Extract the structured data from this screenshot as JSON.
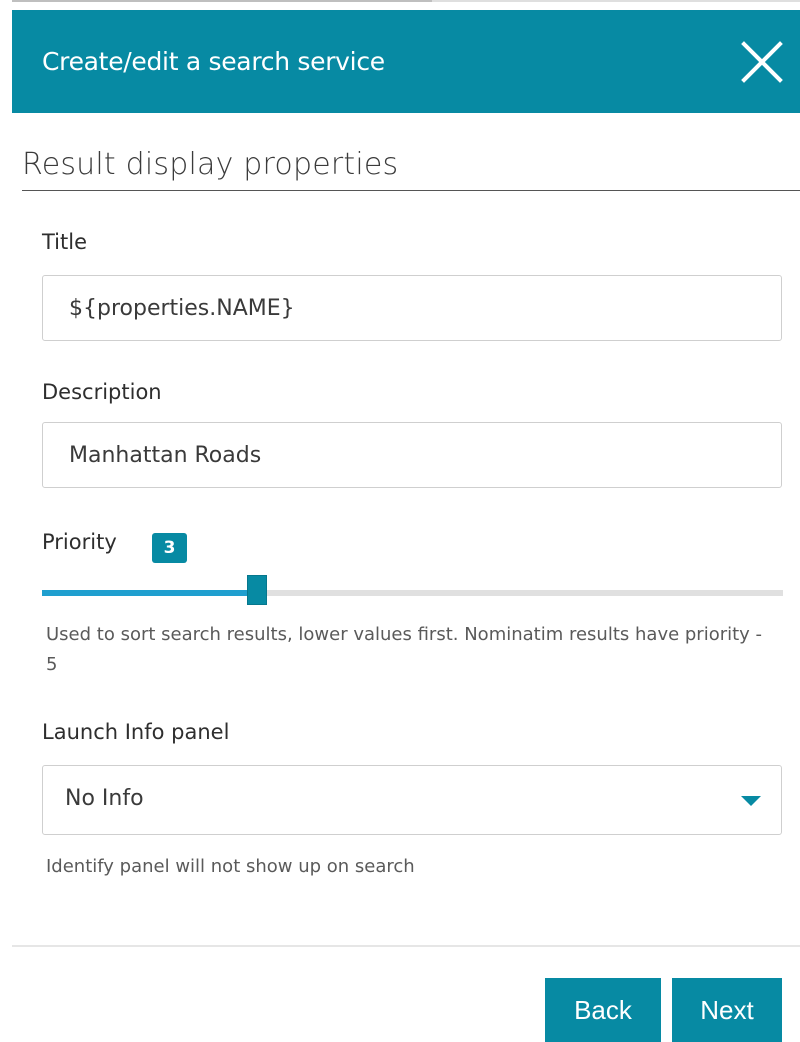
{
  "dialog": {
    "title": "Create/edit a search service",
    "close_icon": "close-icon"
  },
  "section": {
    "title": "Result display properties"
  },
  "fields": {
    "title": {
      "label": "Title",
      "value": "${properties.NAME}"
    },
    "description": {
      "label": "Description",
      "value": "Manhattan Roads"
    },
    "priority": {
      "label": "Priority",
      "value": "3",
      "slider_fraction": 0.29,
      "help": "Used to sort search results, lower values first. Nominatim results have priority - 5"
    },
    "launch_info_panel": {
      "label": "Launch Info panel",
      "selected": "No Info",
      "help": "Identify panel will not show up on search"
    }
  },
  "buttons": {
    "back": "Back",
    "next": "Next"
  },
  "colors": {
    "accent": "#078aa3",
    "slider_fill": "#1f9fcf"
  }
}
